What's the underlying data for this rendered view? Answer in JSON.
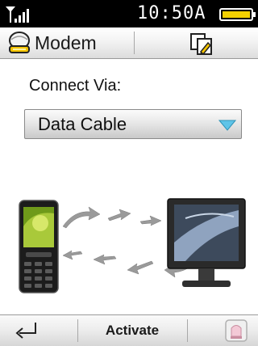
{
  "status_bar": {
    "time": "10:50A",
    "icons": [
      "signal-strength-icon",
      "battery-icon"
    ]
  },
  "title_bar": {
    "title": "Modem",
    "icons": [
      "modem-app-icon",
      "edit-options-icon"
    ]
  },
  "connect": {
    "label": "Connect Via:",
    "selected": "Data Cable",
    "dropdown_icon": "chevron-down-icon"
  },
  "illustration": {
    "icons": [
      "mobile-phone-icon",
      "transfer-arrows-icon",
      "computer-monitor-icon"
    ]
  },
  "softkeys": {
    "left_icon": "back-arrow-icon",
    "center": "Activate",
    "right_icon": "home-icon"
  },
  "colors": {
    "status_bar_bg": "#000000",
    "battery_fill": "#f2d000",
    "dropdown_arrow": "#5fc4e8",
    "text": "#111111"
  }
}
